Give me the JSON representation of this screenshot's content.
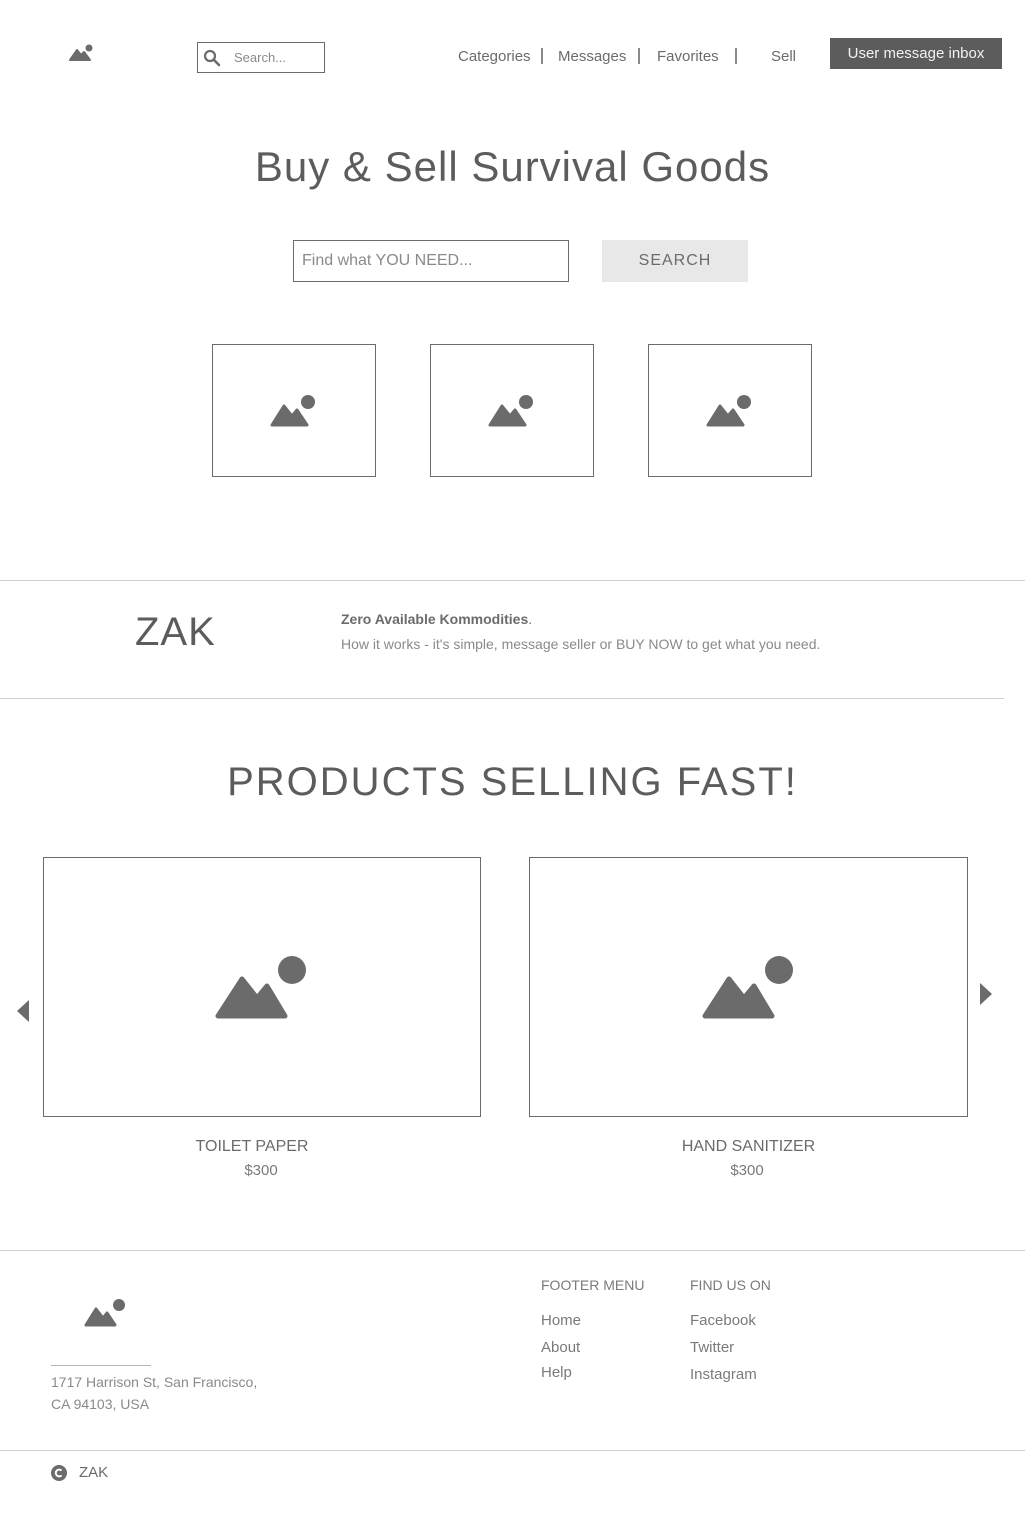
{
  "header": {
    "logo_icon": "image-placeholder-icon",
    "search_placeholder": "Search...",
    "nav": [
      {
        "label": "Categories"
      },
      {
        "label": "Messages"
      },
      {
        "label": "Favorites"
      },
      {
        "label": "Sell"
      }
    ],
    "inbox_button": "User message inbox"
  },
  "hero": {
    "title": "Buy & Sell Survival Goods",
    "search_placeholder": "Find what YOU NEED...",
    "search_button": "SEARCH",
    "thumbnails": [
      "image-placeholder-icon",
      "image-placeholder-icon",
      "image-placeholder-icon"
    ]
  },
  "about": {
    "brand": "ZAK",
    "tagline_strong": "Zero Available Kommodities",
    "tagline_period": ".",
    "description": "How it works - it's simple, message seller or BUY NOW to get what you need."
  },
  "products": {
    "title": "PRODUCTS SELLING FAST!",
    "items": [
      {
        "name": "TOILET PAPER",
        "price": "$300"
      },
      {
        "name": "HAND SANITIZER",
        "price": "$300"
      }
    ],
    "prev_icon": "caret-left-icon",
    "next_icon": "caret-right-icon"
  },
  "footer": {
    "address_line1": "1717 Harrison St, San Francisco,",
    "address_line2": "CA 94103, USA",
    "menu_heading": "FOOTER MENU",
    "menu_links": [
      "Home",
      "About",
      "Help"
    ],
    "social_heading": "FIND US ON",
    "social_links": [
      "Facebook",
      "Twitter",
      "Instagram"
    ],
    "copyright_icon": "copyright-icon",
    "copyright_text": "ZAK"
  },
  "colors": {
    "text": "#6b6b6b",
    "button_dark": "#5c5c5c",
    "button_light": "#e8e8e8",
    "divider": "#cfcfcf"
  }
}
